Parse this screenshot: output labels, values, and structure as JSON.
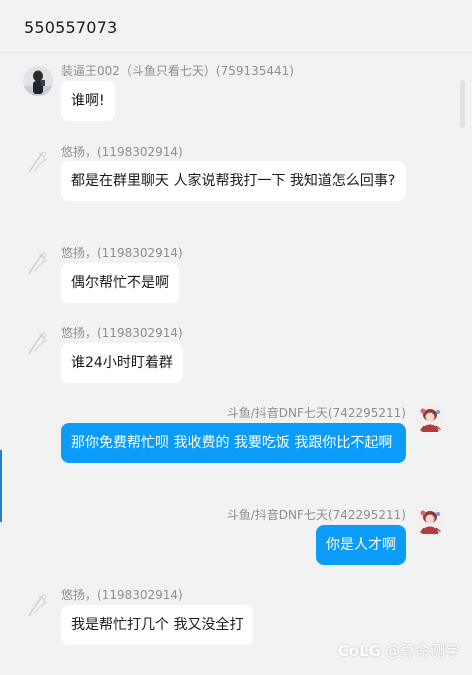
{
  "window": {
    "title": "550557073"
  },
  "messages": [
    {
      "side": "left",
      "avatar": "person-photo-avatar",
      "sender": "装逼王002（斗鱼只看七天）(759135441)",
      "text": "谁啊!"
    },
    {
      "side": "left",
      "avatar": "sketch-character-avatar",
      "sender": "悠扬，(1198302914)",
      "text": "都是在群里聊天   人家说帮我打一下   我知道怎么回事?"
    },
    {
      "side": "left",
      "avatar": "sketch-character-avatar",
      "sender": "悠扬，(1198302914)",
      "text": "偶尔帮忙不是啊"
    },
    {
      "side": "left",
      "avatar": "sketch-character-avatar",
      "sender": "悠扬，(1198302914)",
      "text": "谁24小时盯着群"
    },
    {
      "side": "right",
      "avatar": "anime-character-avatar",
      "sender": "斗鱼/抖音DNF七天(742295211)",
      "text": "那你免费帮忙呗  我收费的  我要吃饭  我跟你比不起啊"
    },
    {
      "side": "right",
      "avatar": "anime-character-avatar",
      "sender": "斗鱼/抖音DNF七天(742295211)",
      "text": "你是人才啊"
    },
    {
      "side": "left",
      "avatar": "sketch-character-avatar",
      "sender": "悠扬，(1198302914)",
      "text": "我是帮忙打几个  我又没全打"
    }
  ],
  "watermark": {
    "logo": "CoLG",
    "text": "@算命测字"
  },
  "colors": {
    "background": "#f2f2f2",
    "bubble_incoming": "#ffffff",
    "bubble_outgoing": "#0a9cf8",
    "sender_text": "#8e8e8e",
    "accent": "#1e7fd8"
  }
}
